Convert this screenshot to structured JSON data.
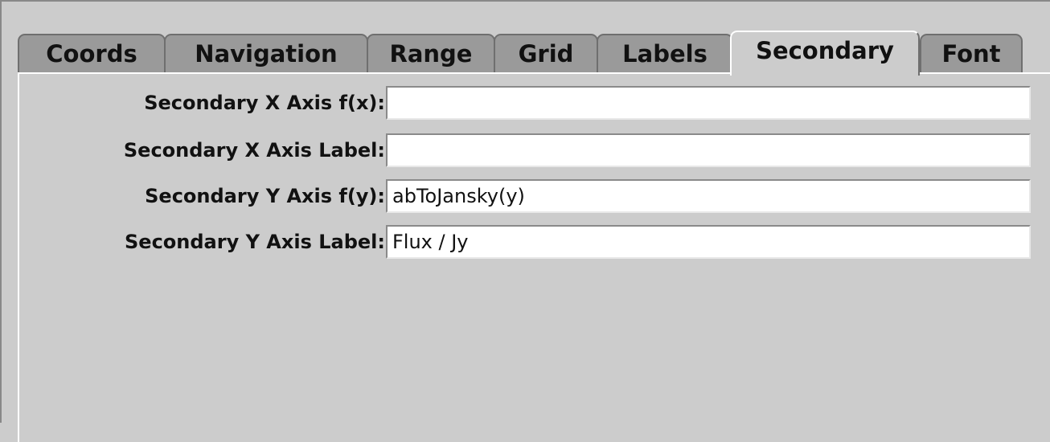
{
  "tabs": [
    {
      "label": "Coords",
      "active": false
    },
    {
      "label": "Navigation",
      "active": false
    },
    {
      "label": "Range",
      "active": false
    },
    {
      "label": "Grid",
      "active": false
    },
    {
      "label": "Labels",
      "active": false
    },
    {
      "label": "Secondary",
      "active": true
    },
    {
      "label": "Font",
      "active": false
    }
  ],
  "form": {
    "rows": [
      {
        "label": "Secondary X Axis f(x):",
        "value": ""
      },
      {
        "label": "Secondary X Axis Label:",
        "value": ""
      },
      {
        "label": "Secondary Y Axis f(y):",
        "value": "abToJansky(y)"
      },
      {
        "label": "Secondary Y Axis Label:",
        "value": "Flux / Jy"
      }
    ]
  }
}
